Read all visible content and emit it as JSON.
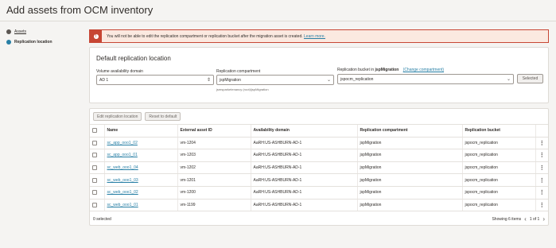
{
  "page": {
    "title": "Add assets from OCM inventory"
  },
  "steps": [
    {
      "label": "Assets",
      "state": "done"
    },
    {
      "label": "Replication location",
      "state": "active"
    }
  ],
  "alert": {
    "message": "You will not be able to edit the replication compartment or replication bucket after the migration asset is created.",
    "link_label": "Learn more."
  },
  "defaults": {
    "title": "Default replication location",
    "ad_label": "Volume availability domain",
    "ad_value": "AD 1",
    "compartment_label": "Replication compartment",
    "compartment_value": "jspMigration",
    "compartment_path": "jsmsparketenancy (root)/jspMigration",
    "bucket_label_prefix": "Replication bucket in",
    "bucket_label_compartment": "jspMigration",
    "change_compartment_label": "(Change compartment)",
    "bucket_value": "jspocm_replication",
    "selected_button": "Selected"
  },
  "toolbar": {
    "edit_label": "Edit replication location",
    "reset_label": "Reset to default"
  },
  "table": {
    "columns": [
      "Name",
      "External asset ID",
      "Availability domain",
      "Replication compartment",
      "Replication bucket"
    ],
    "rows": [
      {
        "name": "sc_app_ooo1_02",
        "id": "vm-1204",
        "ad": "AaRH:US-ASHBURN-AD-1",
        "compartment": "jspMigration",
        "bucket": "jspocm_replication"
      },
      {
        "name": "sc_app_ooo1_01",
        "id": "vm-1203",
        "ad": "AaRH:US-ASHBURN-AD-1",
        "compartment": "jspMigration",
        "bucket": "jspocm_replication"
      },
      {
        "name": "sc_web_ooo1_04",
        "id": "vm-1202",
        "ad": "AaRH:US-ASHBURN-AD-1",
        "compartment": "jspMigration",
        "bucket": "jspocm_replication"
      },
      {
        "name": "sc_web_ooo1_03",
        "id": "vm-1201",
        "ad": "AaRH:US-ASHBURN-AD-1",
        "compartment": "jspMigration",
        "bucket": "jspocm_replication"
      },
      {
        "name": "sc_web_ooo1_02",
        "id": "vm-1200",
        "ad": "AaRH:US-ASHBURN-AD-1",
        "compartment": "jspMigration",
        "bucket": "jspocm_replication"
      },
      {
        "name": "sc_web_ooo1_01",
        "id": "vm-1199",
        "ad": "AaRH:US-ASHBURN-AD-1",
        "compartment": "jspMigration",
        "bucket": "jspocm_replication"
      }
    ],
    "selected_count": "0 selected",
    "showing": "Showing 6 items",
    "page_info": "1 of 1"
  },
  "icons": {
    "alert": "warning-icon",
    "row_menu": "kebab-menu-icon",
    "prev": "chevron-left-icon",
    "next": "chevron-right-icon",
    "select": "chevron-updown-icon"
  },
  "colors": {
    "accent": "#277fa5",
    "alert": "#c74634",
    "background": "#f5f4f2"
  }
}
